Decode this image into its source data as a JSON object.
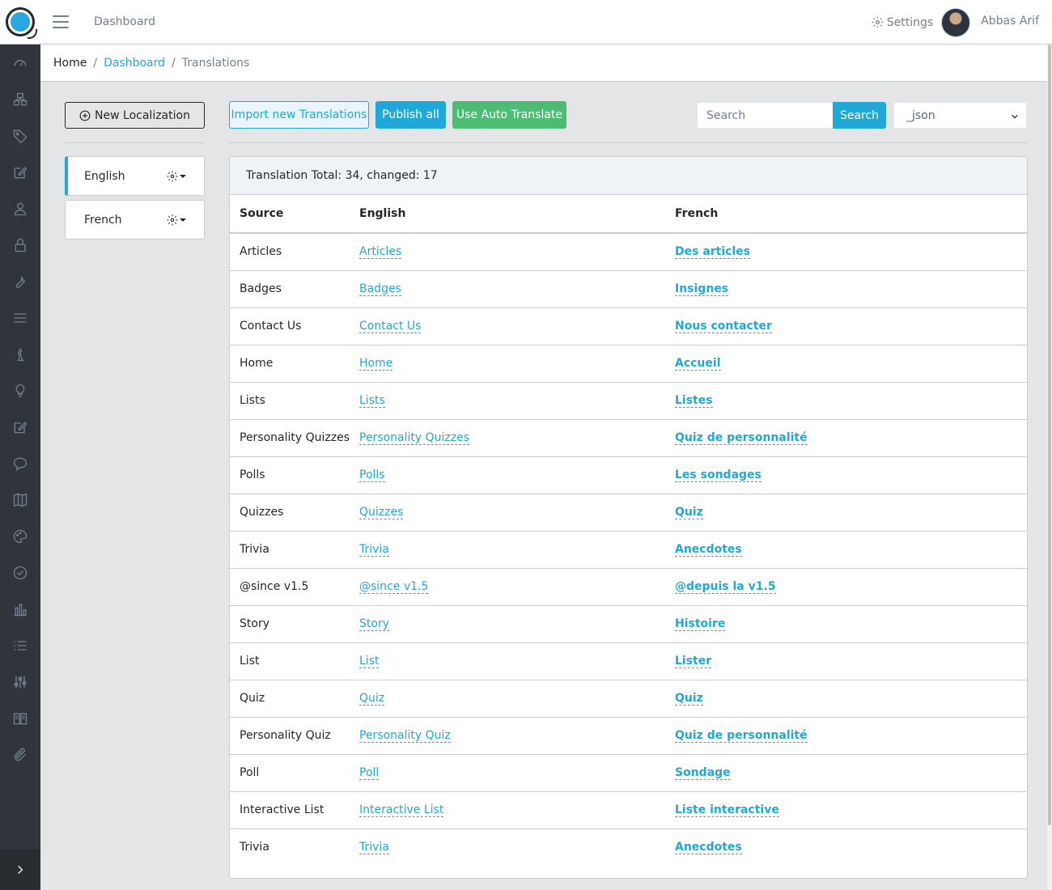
{
  "header": {
    "nav_link": "Dashboard",
    "settings_label": "Settings",
    "username": "Abbas Arif"
  },
  "sidebar": {
    "icons": [
      "speedometer-icon",
      "layers-icon",
      "tag-icon",
      "edit-icon",
      "user-icon",
      "lock-icon",
      "wrench-icon",
      "menu-lines-icon",
      "chess-piece-icon",
      "lightbulb-icon",
      "note-edit-icon",
      "chat-icon",
      "map-icon",
      "palette-icon",
      "check-circle-icon",
      "bar-chart-icon",
      "list-icon",
      "sliders-icon",
      "book-icon",
      "paperclip-icon"
    ]
  },
  "breadcrumb": {
    "home": "Home",
    "dashboard": "Dashboard",
    "current": "Translations"
  },
  "left_panel": {
    "new_localization_label": "New Localization",
    "languages": [
      {
        "label": "English",
        "active": true
      },
      {
        "label": "French",
        "active": false
      }
    ]
  },
  "toolbar": {
    "import_label": "Import new Translations",
    "publish_label": "Publish all",
    "auto_translate_label": "Use Auto Translate",
    "search_placeholder": "Search",
    "search_button_label": "Search",
    "group_selected": "_json"
  },
  "table": {
    "summary": "Translation Total: 34, changed: 17",
    "headers": {
      "source": "Source",
      "english": "English",
      "french": "French"
    },
    "rows": [
      {
        "source": "Articles",
        "english": "Articles",
        "french": "Des articles"
      },
      {
        "source": "Badges",
        "english": "Badges",
        "french": "Insignes"
      },
      {
        "source": "Contact Us",
        "english": "Contact Us",
        "french": "Nous contacter"
      },
      {
        "source": "Home",
        "english": "Home",
        "french": "Accueil"
      },
      {
        "source": "Lists",
        "english": "Lists",
        "french": "Listes"
      },
      {
        "source": "Personality Quizzes",
        "english": "Personality Quizzes",
        "french": "Quiz de personnalité"
      },
      {
        "source": "Polls",
        "english": "Polls",
        "french": "Les sondages"
      },
      {
        "source": "Quizzes",
        "english": "Quizzes",
        "french": "Quiz"
      },
      {
        "source": "Trivia",
        "english": "Trivia",
        "french": "Anecdotes"
      },
      {
        "source": "@since v1.5",
        "english": "@since v1.5",
        "french": "@depuis la v1.5"
      },
      {
        "source": "Story",
        "english": "Story",
        "french": "Histoire"
      },
      {
        "source": "List",
        "english": "List",
        "french": "Lister"
      },
      {
        "source": "Quiz",
        "english": "Quiz",
        "french": "Quiz"
      },
      {
        "source": "Personality Quiz",
        "english": "Personality Quiz",
        "french": "Quiz de personnalité"
      },
      {
        "source": "Poll",
        "english": "Poll",
        "french": "Sondage"
      },
      {
        "source": "Interactive List",
        "english": "Interactive List",
        "french": "Liste interactive"
      },
      {
        "source": "Trivia",
        "english": "Trivia",
        "french": "Anecdotes"
      }
    ]
  },
  "colors": {
    "primary": "#20a8d8",
    "success": "#4dbd74",
    "sidebar_bg": "#2f353a",
    "page_bg": "#e4e5e6"
  }
}
